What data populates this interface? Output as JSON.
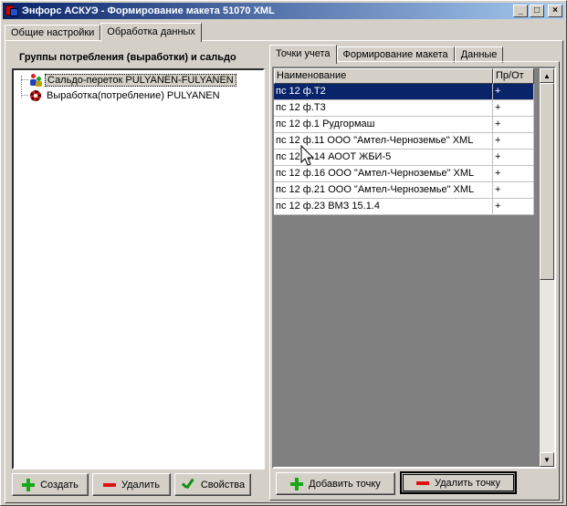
{
  "window": {
    "title": "Энфорс АСКУЭ - Формирование макета 51070 XML",
    "min_label": "_",
    "max_label": "□",
    "close_label": "×"
  },
  "tabs_top": [
    {
      "label": "Общие настройки"
    },
    {
      "label": "Обработка данных"
    }
  ],
  "left_panel": {
    "title": "Группы потребления (выработки) и сальдо",
    "tree": [
      {
        "label": "Сальдо-переток PULYANEN-FULYANEN",
        "icon": "group-people-icon"
      },
      {
        "label": "Выработка(потребление) PULYANEN",
        "icon": "gear-icon"
      }
    ],
    "buttons": {
      "create": "Создать",
      "delete": "Удалить",
      "properties": "Свойства"
    }
  },
  "tabs_right": [
    {
      "label": "Точки учета"
    },
    {
      "label": "Формирование макета"
    },
    {
      "label": "Данные"
    }
  ],
  "grid": {
    "columns": [
      "Наименование",
      "Пр/От"
    ],
    "rows": [
      [
        "пс 12 ф.Т2",
        "+"
      ],
      [
        "пс 12 ф.Т3",
        "+"
      ],
      [
        "пс 12 ф.1 Рудгормаш",
        "+"
      ],
      [
        "пс 12 ф.11 ООО \"Амтел-Черноземье\" XML",
        "+"
      ],
      [
        "пс 12 ф.14 АООТ ЖБИ-5",
        "+"
      ],
      [
        "пс 12 ф.16 ООО \"Амтел-Черноземье\" XML",
        "+"
      ],
      [
        "пс 12 ф.21 ООО \"Амтел-Черноземье\" XML",
        "+"
      ],
      [
        "пс 12 ф.23 ВМЗ 15.1.4",
        "+"
      ]
    ]
  },
  "right_buttons": {
    "add_point": "Добавить точку",
    "delete_point": "Удалить точку"
  },
  "colors": {
    "title_gradient_start": "#0a246a",
    "title_gradient_end": "#a6caf0",
    "selection": "#0a246a",
    "face": "#d4d0c8"
  }
}
